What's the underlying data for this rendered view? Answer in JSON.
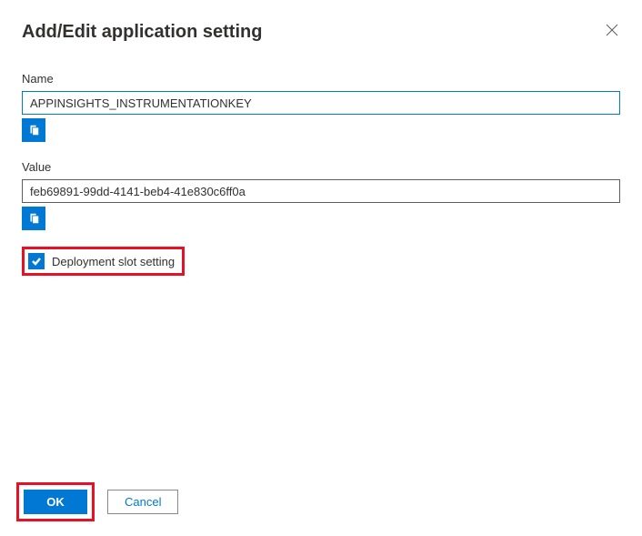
{
  "header": {
    "title": "Add/Edit application setting"
  },
  "fields": {
    "name": {
      "label": "Name",
      "value": "APPINSIGHTS_INSTRUMENTATIONKEY"
    },
    "value": {
      "label": "Value",
      "value": "feb69891-99dd-4141-beb4-41e830c6ff0a"
    }
  },
  "checkbox": {
    "label": "Deployment slot setting",
    "checked": true
  },
  "buttons": {
    "ok": "OK",
    "cancel": "Cancel"
  }
}
